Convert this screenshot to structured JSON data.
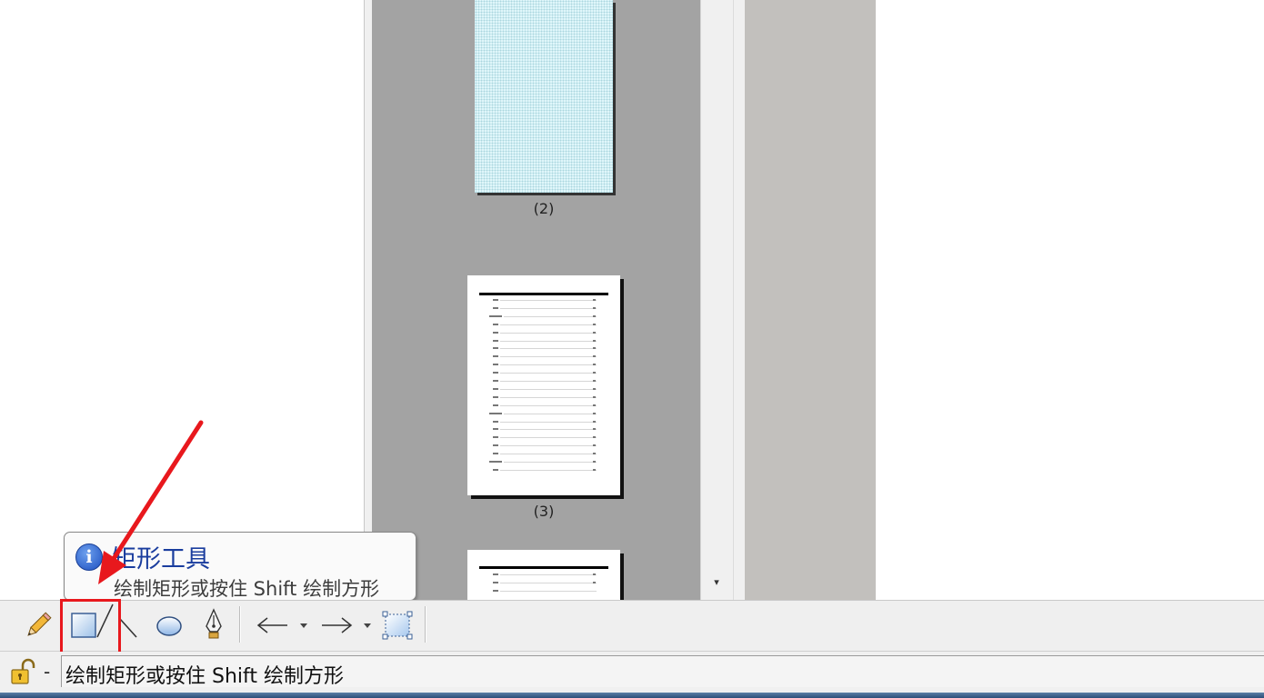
{
  "thumbnails": {
    "page2_label": "(2)",
    "page3_label": "(3)"
  },
  "tooltip": {
    "icon": "info-icon",
    "title": "矩形工具",
    "description": "绘制矩形或按住 Shift 绘制方形"
  },
  "toolbar": {
    "tools": [
      "pencil-icon",
      "rectangle-icon",
      "line-icon",
      "ellipse-icon",
      "pen-icon",
      "arrow-left-icon",
      "arrow-right-icon",
      "selection-icon"
    ]
  },
  "statusbar": {
    "lock_icon": "lock-open-icon",
    "dash": "-",
    "text": "绘制矩形或按住 Shift 绘制方形"
  },
  "colors": {
    "highlight": "#e8181d",
    "tooltip_title": "#1a3d9e",
    "thumb_background": "#a3a3a3"
  }
}
